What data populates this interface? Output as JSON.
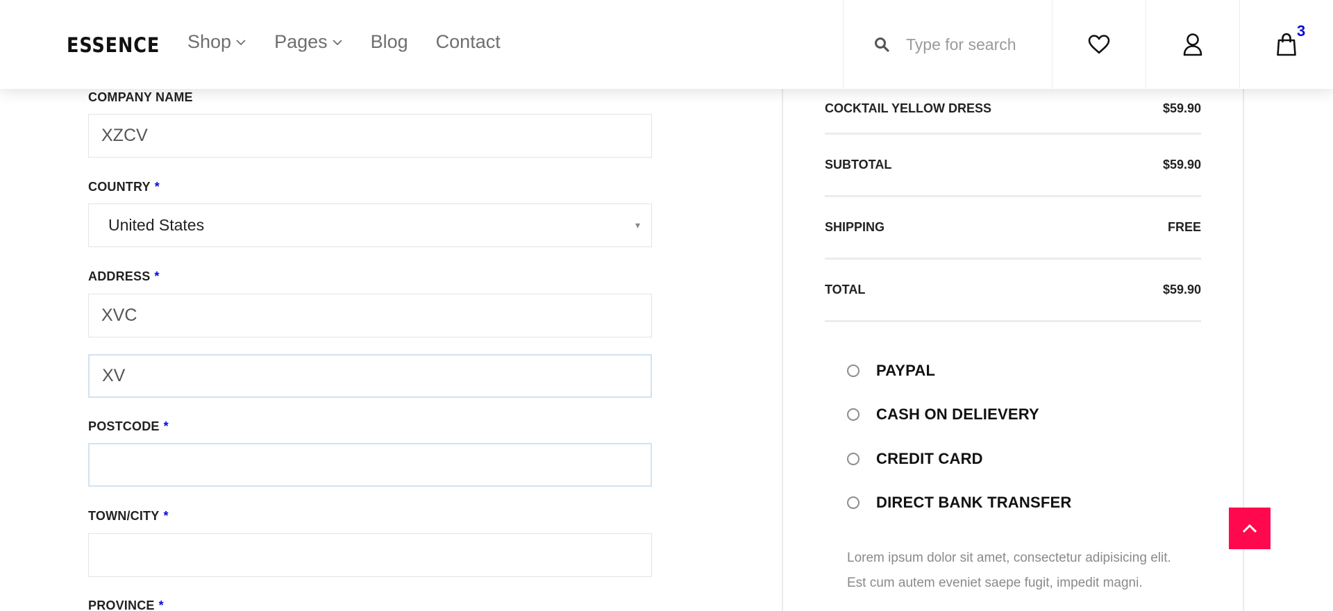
{
  "header": {
    "logo": "ESSENCE",
    "nav": [
      {
        "label": "Shop",
        "has_dropdown": true
      },
      {
        "label": "Pages",
        "has_dropdown": true
      },
      {
        "label": "Blog",
        "has_dropdown": false
      },
      {
        "label": "Contact",
        "has_dropdown": false
      }
    ],
    "search_placeholder": "Type for search",
    "cart_count": "3",
    "icons": [
      "search-icon",
      "heart-icon",
      "user-icon",
      "shopping-bag-icon"
    ]
  },
  "form": {
    "company": {
      "label": "COMPANY NAME",
      "value": "XZCV"
    },
    "country": {
      "label": "COUNTRY",
      "required": "*",
      "value": "United States"
    },
    "address": {
      "label": "ADDRESS",
      "required": "*",
      "line1": "XVC",
      "line2": "XV"
    },
    "postcode": {
      "label": "POSTCODE",
      "required": "*",
      "value": ""
    },
    "town": {
      "label": "TOWN/CITY",
      "required": "*",
      "value": ""
    },
    "province": {
      "label": "PROVINCE",
      "required": "*"
    }
  },
  "summary": {
    "item": {
      "name": "COCKTAIL YELLOW DRESS",
      "price": "$59.90"
    },
    "subtotal": {
      "label": "SUBTOTAL",
      "value": "$59.90"
    },
    "shipping": {
      "label": "SHIPPING",
      "value": "FREE"
    },
    "total": {
      "label": "TOTAL",
      "value": "$59.90"
    },
    "payment_methods": [
      "PAYPAL",
      "CASH ON DELIEVERY",
      "CREDIT CARD",
      "DIRECT BANK TRANSFER"
    ],
    "description": "Lorem ipsum dolor sit amet, consectetur adipisicing elit. Est cum autem eveniet saepe fugit, impedit magni."
  },
  "colors": {
    "accent": "#0b0bd9",
    "back_to_top": "#ff084e"
  }
}
